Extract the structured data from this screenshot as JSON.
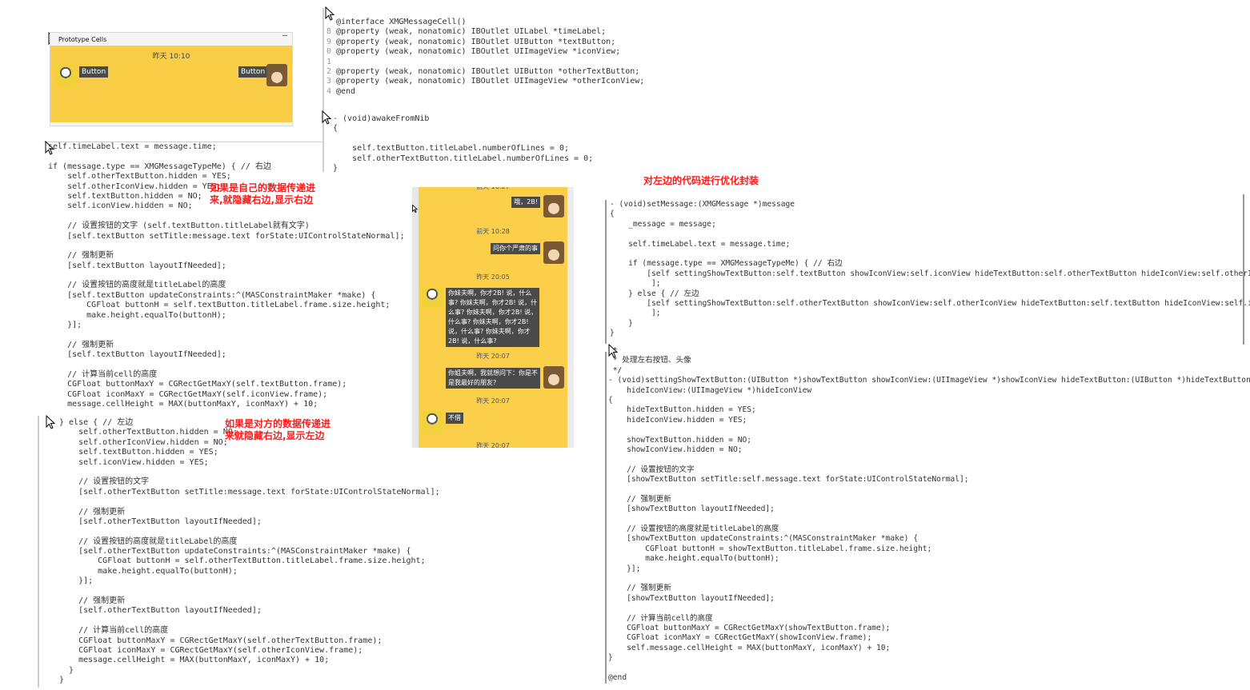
{
  "proto": {
    "title": "Prototype Cells",
    "minus": "—",
    "time": "昨天 10:10",
    "left_button": "Button",
    "right_button": "Button"
  },
  "header_code": [
    {
      "n": "",
      "t": "@interface XMGMessageCell()"
    },
    {
      "n": "8",
      "t": "@property (weak, nonatomic) IBOutlet UILabel *timeLabel;"
    },
    {
      "n": "9",
      "t": "@property (weak, nonatomic) IBOutlet UIButton *textButton;"
    },
    {
      "n": "0",
      "t": "@property (weak, nonatomic) IBOutlet UIImageView *iconView;"
    },
    {
      "n": "1",
      "t": ""
    },
    {
      "n": "2",
      "t": "@property (weak, nonatomic) IBOutlet UIButton *otherTextButton;"
    },
    {
      "n": "3",
      "t": "@property (weak, nonatomic) IBOutlet UIImageView *otherIconView;"
    },
    {
      "n": "4",
      "t": "@end"
    }
  ],
  "awake_code": [
    "- (void)awakeFromNib",
    "{",
    "",
    "    self.textButton.titleLabel.numberOfLines = 0;",
    "    self.otherTextButton.titleLabel.numberOfLines = 0;",
    "}"
  ],
  "left_code_1": [
    "self.timeLabel.text = message.time;",
    "",
    "if (message.type == XMGMessageTypeMe) { // 右边",
    "    self.otherTextButton.hidden = YES;",
    "    self.otherIconView.hidden = YES;",
    "    self.textButton.hidden = NO;",
    "    self.iconView.hidden = NO;",
    "",
    "    // 设置按钮的文字 (self.textButton.titleLabel就有文字)",
    "    [self.textButton setTitle:message.text forState:UIControlStateNormal];",
    "",
    "    // 强制更新",
    "    [self.textButton layoutIfNeeded];",
    "",
    "    // 设置按钮的高度就是titleLabel的高度",
    "    [self.textButton updateConstraints:^(MASConstraintMaker *make) {",
    "        CGFloat buttonH = self.textButton.titleLabel.frame.size.height;",
    "        make.height.equalTo(buttonH);",
    "    }];",
    "",
    "    // 强制更新",
    "    [self.textButton layoutIfNeeded];",
    "",
    "    // 计算当前cell的高度",
    "    CGFloat buttonMaxY = CGRectGetMaxY(self.textButton.frame);",
    "    CGFloat iconMaxY = CGRectGetMaxY(self.iconView.frame);",
    "    message.cellHeight = MAX(buttonMaxY, iconMaxY) + 10;"
  ],
  "left_code_2": [
    "} else { // 左边",
    "    self.otherTextButton.hidden = NO;",
    "    self.otherIconView.hidden = NO;",
    "    self.textButton.hidden = YES;",
    "    self.iconView.hidden = YES;",
    "",
    "    // 设置按钮的文字",
    "    [self.otherTextButton setTitle:message.text forState:UIControlStateNormal];",
    "",
    "    // 强制更新",
    "    [self.otherTextButton layoutIfNeeded];",
    "",
    "    // 设置按钮的高度就是titleLabel的高度",
    "    [self.otherTextButton updateConstraints:^(MASConstraintMaker *make) {",
    "        CGFloat buttonH = self.otherTextButton.titleLabel.frame.size.height;",
    "        make.height.equalTo(buttonH);",
    "    }];",
    "",
    "    // 强制更新",
    "    [self.otherTextButton layoutIfNeeded];",
    "",
    "    // 计算当前cell的高度",
    "    CGFloat buttonMaxY = CGRectGetMaxY(self.otherTextButton.frame);",
    "    CGFloat iconMaxY = CGRectGetMaxY(self.otherIconView.frame);",
    "    message.cellHeight = MAX(buttonMaxY, iconMaxY) + 10;",
    "  }",
    "}"
  ],
  "notes": {
    "note1": "如果是自己的数据传递进\n来,就隐藏右边,显示右边",
    "note2": "如果是对方的数据传递进\n来就隐藏右边,显示左边",
    "note3": "对左边的代码进行优化封装"
  },
  "chat": {
    "items": [
      {
        "kind": "time",
        "text": "前天 10:27"
      },
      {
        "kind": "right",
        "text": "哦，2B!"
      },
      {
        "kind": "time",
        "text": "前天 10:28"
      },
      {
        "kind": "right",
        "text": "问你个严肃的事"
      },
      {
        "kind": "time",
        "text": "昨天 20:05"
      },
      {
        "kind": "left",
        "text": "你妹夫啊，你才2B! 说，什么\n事? 你妹夫啊，你才2B! 说，什\n么事? 你妹夫啊，你才2B! 说，\n什么事? 你妹夫啊，你才2B!\n说，什么事? 你妹夫啊，你才\n2B! 说，什么事?"
      },
      {
        "kind": "time",
        "text": "昨天 20:07"
      },
      {
        "kind": "right",
        "text": "你姐夫啊，我就想问下：你是不\n是我最好的朋友?"
      },
      {
        "kind": "time",
        "text": "昨天 20:07"
      },
      {
        "kind": "left",
        "text": "不借"
      },
      {
        "kind": "time",
        "text": "昨天 20:07"
      }
    ]
  },
  "right_code_1": [
    "- (void)setMessage:(XMGMessage *)message",
    "{",
    "    _message = message;",
    "",
    "    self.timeLabel.text = message.time;",
    "",
    "    if (message.type == XMGMessageTypeMe) { // 右边",
    "        [self settingShowTextButton:self.textButton showIconView:self.iconView hideTextButton:self.otherTextButton hideIconView:self.otherIconView",
    "         ];",
    "    } else { // 左边",
    "        [self settingShowTextButton:self.otherTextButton showIconView:self.otherIconView hideTextButton:self.textButton hideIconView:self.iconView",
    "         ];",
    "    }",
    "}"
  ],
  "right_code_2": [
    " *",
    " * 处理左右按钮、头像",
    " */",
    "- (void)settingShowTextButton:(UIButton *)showTextButton showIconView:(UIImageView *)showIconView hideTextButton:(UIButton *)hideTextButton",
    "    hideIconView:(UIImageView *)hideIconView",
    "{",
    "    hideTextButton.hidden = YES;",
    "    hideIconView.hidden = YES;",
    "",
    "    showTextButton.hidden = NO;",
    "    showIconView.hidden = NO;",
    "",
    "    // 设置按钮的文字",
    "    [showTextButton setTitle:self.message.text forState:UIControlStateNormal];",
    "",
    "    // 强制更新",
    "    [showTextButton layoutIfNeeded];",
    "",
    "    // 设置按钮的高度就是titleLabel的高度",
    "    [showTextButton updateConstraints:^(MASConstraintMaker *make) {",
    "        CGFloat buttonH = showTextButton.titleLabel.frame.size.height;",
    "        make.height.equalTo(buttonH);",
    "    }];",
    "",
    "    // 强制更新",
    "    [showTextButton layoutIfNeeded];",
    "",
    "    // 计算当前cell的高度",
    "    CGFloat buttonMaxY = CGRectGetMaxY(showTextButton.frame);",
    "    CGFloat iconMaxY = CGRectGetMaxY(showIconView.frame);",
    "    self.message.cellHeight = MAX(buttonMaxY, iconMaxY) + 10;",
    "}",
    "",
    "@end"
  ]
}
